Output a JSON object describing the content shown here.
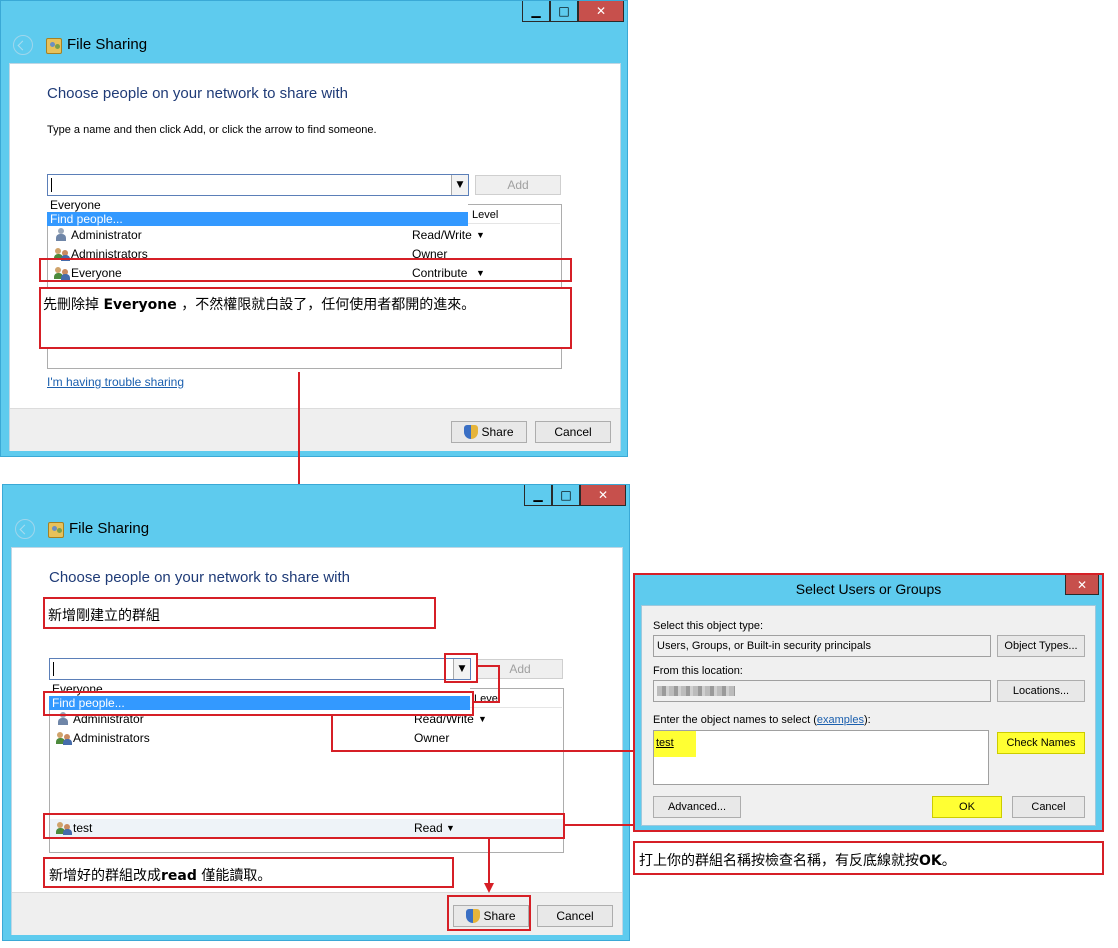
{
  "top_window": {
    "title": "File Sharing",
    "heading": "Choose people on your network to share with",
    "instruction": "Type a name and then click Add, or click the arrow to find someone.",
    "add_label": "Add",
    "dropdown_options": [
      "Everyone",
      "Find people..."
    ],
    "column_level": "Level",
    "rows": [
      {
        "name": "Administrator",
        "level": "Read/Write",
        "icon": "user-icon"
      },
      {
        "name": "Administrators",
        "level": "Owner",
        "icon": "group-icon"
      },
      {
        "name": "Everyone",
        "level": "Contribute",
        "icon": "group-icon"
      }
    ],
    "trouble_link": "I'm having trouble sharing",
    "share_label": "Share",
    "cancel_label": "Cancel"
  },
  "bottom_window": {
    "title": "File Sharing",
    "heading": "Choose people on your network to share with",
    "add_label": "Add",
    "dropdown_options": [
      "Everyone",
      "Find people..."
    ],
    "column_level": "Level",
    "rows": [
      {
        "name": "Administrator",
        "level": "Read/Write",
        "icon": "user-icon"
      },
      {
        "name": "Administrators",
        "level": "Owner",
        "icon": "group-icon"
      },
      {
        "name": "test",
        "level": "Read",
        "icon": "group-icon"
      }
    ],
    "share_label": "Share",
    "cancel_label": "Cancel"
  },
  "select_dialog": {
    "title": "Select Users or Groups",
    "object_type_label": "Select this object type:",
    "object_type_value": "Users, Groups, or Built-in security principals",
    "object_types_button": "Object Types...",
    "location_label": "From this location:",
    "locations_button": "Locations...",
    "names_label_prefix": "Enter the object names to select (",
    "names_label_link": "examples",
    "names_label_suffix": "):",
    "names_value": "test",
    "check_names_button": "Check Names",
    "advanced_button": "Advanced...",
    "ok_button": "OK",
    "cancel_button": "Cancel"
  },
  "annotations": {
    "top_note_prefix": "先刪除掉 ",
    "top_note_bold": "Everyone",
    "top_note_suffix": " ，不然權限就白設了，任何使用者都開的進來。",
    "add_group_note": "新增剛建立的群組",
    "read_note_prefix": "新增好的群組改成",
    "read_note_bold": "read",
    "read_note_suffix": " 僅能讀取。",
    "dialog_note_prefix": "打上你的群組名稱按檢查名稱，有反底線就按",
    "dialog_note_bold": "OK",
    "dialog_note_suffix": "。"
  },
  "colors": {
    "window_frame": "#5ecbee",
    "annotation_red": "#d61f26",
    "highlight_yellow": "#ffff33",
    "selection_blue": "#3399ff"
  }
}
